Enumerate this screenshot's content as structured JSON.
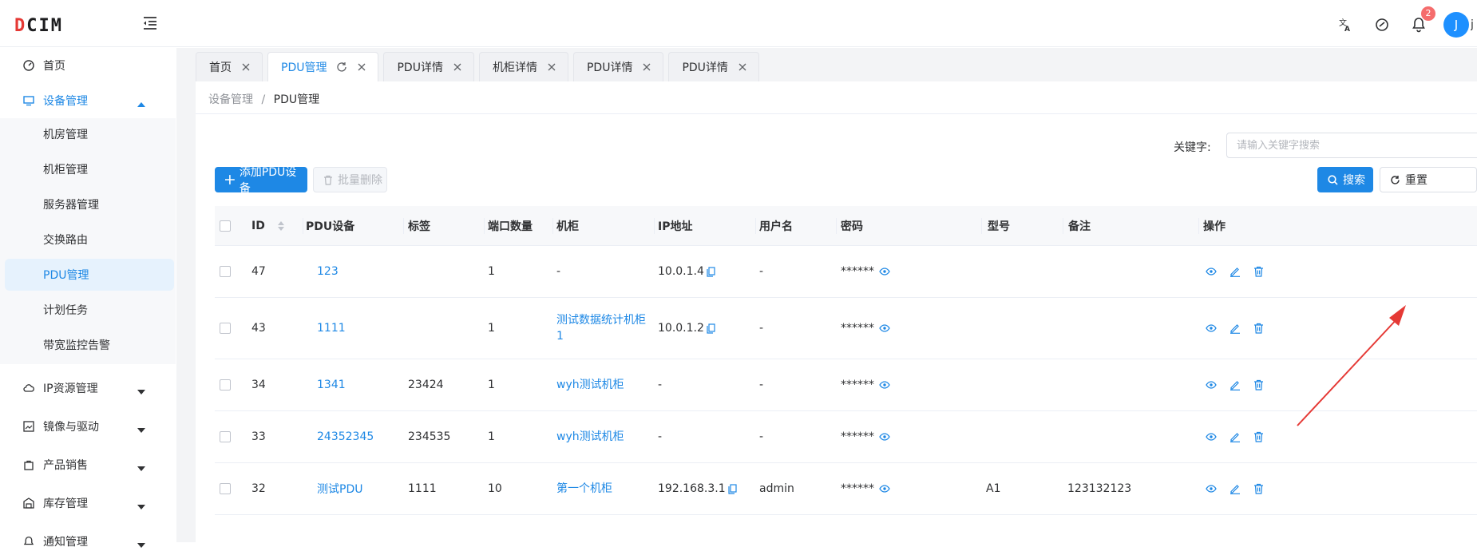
{
  "app": {
    "logo": "DCIM"
  },
  "topbar": {
    "notification_count": "2",
    "avatar_letter": "J",
    "username": "j"
  },
  "sidebar": {
    "home": "首页",
    "device_mgmt": "设备管理",
    "sub": [
      "机房管理",
      "机柜管理",
      "服务器管理",
      "交换路由",
      "PDU管理",
      "计划任务",
      "带宽监控告警"
    ],
    "ip": "IP资源管理",
    "image": "镜像与驱动",
    "sales": "产品销售",
    "stock": "库存管理",
    "notify": "通知管理"
  },
  "tabs": [
    {
      "label": "首页"
    },
    {
      "label": "PDU管理"
    },
    {
      "label": "PDU详情"
    },
    {
      "label": "机柜详情"
    },
    {
      "label": "PDU详情"
    },
    {
      "label": "PDU详情"
    }
  ],
  "breadcrumb": {
    "parent": "设备管理",
    "sep": "/",
    "current": "PDU管理"
  },
  "search": {
    "label": "关键字:",
    "placeholder": "请输入关键字搜索",
    "search_btn": "搜索",
    "reset_btn": "重置"
  },
  "toolbar": {
    "add_btn": "添加PDU设备",
    "batch_delete_btn": "批量删除"
  },
  "table": {
    "headers": [
      "ID",
      "PDU设备",
      "标签",
      "端口数量",
      "机柜",
      "IP地址",
      "用户名",
      "密码",
      "型号",
      "备注",
      "操作"
    ],
    "rows": [
      {
        "id": "47",
        "device": "123",
        "tag": "",
        "ports": "1",
        "cabinet": "-",
        "cabinet_line2": "",
        "ip": "10.0.1.4",
        "user": "-",
        "pwd": "******",
        "model": "",
        "note": ""
      },
      {
        "id": "43",
        "device": "1111",
        "tag": "",
        "ports": "1",
        "cabinet": "测试数据统计机柜",
        "cabinet_line2": "1",
        "ip": "10.0.1.2",
        "user": "-",
        "pwd": "******",
        "model": "",
        "note": ""
      },
      {
        "id": "34",
        "device": "1341",
        "tag": "23424",
        "ports": "1",
        "cabinet": "wyh测试机柜",
        "cabinet_line2": "",
        "ip": "-",
        "user": "-",
        "pwd": "******",
        "model": "",
        "note": ""
      },
      {
        "id": "33",
        "device": "24352345",
        "tag": "234535",
        "ports": "1",
        "cabinet": "wyh测试机柜",
        "cabinet_line2": "",
        "ip": "-",
        "user": "-",
        "pwd": "******",
        "model": "",
        "note": ""
      },
      {
        "id": "32",
        "device": "测试PDU",
        "tag": "1111",
        "ports": "10",
        "cabinet": "第一个机柜",
        "cabinet_line2": "",
        "ip": "192.168.3.1",
        "user": "admin",
        "pwd": "******",
        "model": "A1",
        "note": "123132123"
      }
    ]
  },
  "colors": {
    "primary": "#1e88e5",
    "annotation_arrow": "#e53935",
    "badge": "#f56c6c"
  }
}
